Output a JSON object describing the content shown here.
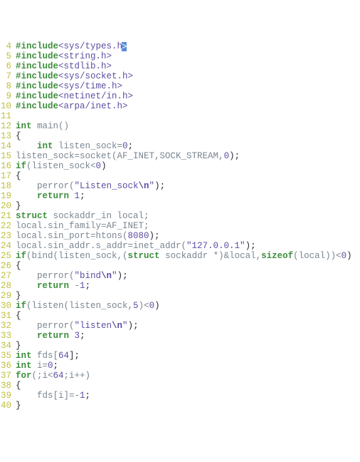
{
  "lines": [
    {
      "n": 4,
      "tokens": [
        {
          "t": "#include",
          "c": "pp"
        },
        {
          "t": "<sys/types.h",
          "c": "hdr"
        },
        {
          "t": ">",
          "c": "hdr",
          "cursor": true
        }
      ]
    },
    {
      "n": 5,
      "tokens": [
        {
          "t": "#include",
          "c": "pp"
        },
        {
          "t": "<string.h>",
          "c": "hdr"
        }
      ]
    },
    {
      "n": 6,
      "tokens": [
        {
          "t": "#include",
          "c": "pp"
        },
        {
          "t": "<stdlib.h>",
          "c": "hdr"
        }
      ]
    },
    {
      "n": 7,
      "tokens": [
        {
          "t": "#include",
          "c": "pp"
        },
        {
          "t": "<sys/socket.h>",
          "c": "hdr"
        }
      ]
    },
    {
      "n": 8,
      "tokens": [
        {
          "t": "#include",
          "c": "pp"
        },
        {
          "t": "<sys/time.h>",
          "c": "hdr"
        }
      ]
    },
    {
      "n": 9,
      "tokens": [
        {
          "t": "#include",
          "c": "pp"
        },
        {
          "t": "<netinet/in.h>",
          "c": "hdr"
        }
      ]
    },
    {
      "n": 10,
      "tokens": [
        {
          "t": "#include",
          "c": "pp"
        },
        {
          "t": "<arpa/inet.h>",
          "c": "hdr"
        }
      ]
    },
    {
      "n": 11,
      "tokens": []
    },
    {
      "n": 12,
      "tokens": [
        {
          "t": "int",
          "c": "kw"
        },
        {
          "t": " main()",
          "c": "ty"
        }
      ]
    },
    {
      "n": 13,
      "tokens": [
        {
          "t": "{",
          "c": "p"
        }
      ]
    },
    {
      "n": 14,
      "tokens": [
        {
          "t": "    ",
          "c": "p"
        },
        {
          "t": "int",
          "c": "kw"
        },
        {
          "t": " listen_sock=",
          "c": "ty"
        },
        {
          "t": "0",
          "c": "num"
        },
        {
          "t": ";",
          "c": "p"
        }
      ]
    },
    {
      "n": 15,
      "tokens": [
        {
          "t": "listen_sock=socket(AF_INET,SOCK_STREAM,",
          "c": "ty"
        },
        {
          "t": "0",
          "c": "num"
        },
        {
          "t": ");",
          "c": "p"
        }
      ]
    },
    {
      "n": 16,
      "tokens": [
        {
          "t": "if",
          "c": "kw"
        },
        {
          "t": "(listen_sock<",
          "c": "ty"
        },
        {
          "t": "0",
          "c": "num"
        },
        {
          "t": ")",
          "c": "p"
        }
      ]
    },
    {
      "n": 17,
      "tokens": [
        {
          "t": "{",
          "c": "p"
        }
      ]
    },
    {
      "n": 18,
      "tokens": [
        {
          "t": "    perror(",
          "c": "ty"
        },
        {
          "t": "\"Listen_sock",
          "c": "str"
        },
        {
          "t": "\\n",
          "c": "esc"
        },
        {
          "t": "\"",
          "c": "str"
        },
        {
          "t": ");",
          "c": "p"
        }
      ]
    },
    {
      "n": 19,
      "tokens": [
        {
          "t": "    ",
          "c": "p"
        },
        {
          "t": "return",
          "c": "kw"
        },
        {
          "t": " ",
          "c": "p"
        },
        {
          "t": "1",
          "c": "num"
        },
        {
          "t": ";",
          "c": "p"
        }
      ]
    },
    {
      "n": 20,
      "tokens": [
        {
          "t": "}",
          "c": "p"
        }
      ]
    },
    {
      "n": 21,
      "tokens": [
        {
          "t": "struct",
          "c": "kw"
        },
        {
          "t": " sockaddr_in local;",
          "c": "ty"
        }
      ]
    },
    {
      "n": 22,
      "tokens": [
        {
          "t": "local.sin_family=AF_INET;",
          "c": "ty"
        }
      ]
    },
    {
      "n": 23,
      "tokens": [
        {
          "t": "local.sin_port=htons(",
          "c": "ty"
        },
        {
          "t": "8080",
          "c": "num"
        },
        {
          "t": ");",
          "c": "p"
        }
      ]
    },
    {
      "n": 24,
      "tokens": [
        {
          "t": "local.sin_addr.s_addr=inet_addr(",
          "c": "ty"
        },
        {
          "t": "\"127.0.0.1\"",
          "c": "str"
        },
        {
          "t": ");",
          "c": "p"
        }
      ]
    },
    {
      "n": 25,
      "tokens": [
        {
          "t": "if",
          "c": "kw"
        },
        {
          "t": "(bind(listen_sock,(",
          "c": "ty"
        },
        {
          "t": "struct",
          "c": "kw"
        },
        {
          "t": " sockaddr *)&local,",
          "c": "ty"
        },
        {
          "t": "sizeof",
          "c": "kw"
        },
        {
          "t": "(local))<",
          "c": "ty"
        },
        {
          "t": "0",
          "c": "num"
        },
        {
          "t": ")",
          "c": "p"
        }
      ]
    },
    {
      "n": 26,
      "tokens": [
        {
          "t": "{",
          "c": "p"
        }
      ]
    },
    {
      "n": 27,
      "tokens": [
        {
          "t": "    perror(",
          "c": "ty"
        },
        {
          "t": "\"bind",
          "c": "str"
        },
        {
          "t": "\\n",
          "c": "esc"
        },
        {
          "t": "\"",
          "c": "str"
        },
        {
          "t": ");",
          "c": "p"
        }
      ]
    },
    {
      "n": 28,
      "tokens": [
        {
          "t": "    ",
          "c": "p"
        },
        {
          "t": "return",
          "c": "kw"
        },
        {
          "t": " -",
          "c": "ty"
        },
        {
          "t": "1",
          "c": "num"
        },
        {
          "t": ";",
          "c": "p"
        }
      ]
    },
    {
      "n": 29,
      "tokens": [
        {
          "t": "}",
          "c": "p"
        }
      ]
    },
    {
      "n": 30,
      "tokens": [
        {
          "t": "if",
          "c": "kw"
        },
        {
          "t": "(listen(listen_sock,",
          "c": "ty"
        },
        {
          "t": "5",
          "c": "num"
        },
        {
          "t": ")<",
          "c": "ty"
        },
        {
          "t": "0",
          "c": "num"
        },
        {
          "t": ")",
          "c": "p"
        }
      ]
    },
    {
      "n": 31,
      "tokens": [
        {
          "t": "{",
          "c": "p"
        }
      ]
    },
    {
      "n": 32,
      "tokens": [
        {
          "t": "    perror(",
          "c": "ty"
        },
        {
          "t": "\"listen",
          "c": "str"
        },
        {
          "t": "\\n",
          "c": "esc"
        },
        {
          "t": "\"",
          "c": "str"
        },
        {
          "t": ");",
          "c": "p"
        }
      ]
    },
    {
      "n": 33,
      "tokens": [
        {
          "t": "    ",
          "c": "p"
        },
        {
          "t": "return",
          "c": "kw"
        },
        {
          "t": " ",
          "c": "p"
        },
        {
          "t": "3",
          "c": "num"
        },
        {
          "t": ";",
          "c": "p"
        }
      ]
    },
    {
      "n": 34,
      "tokens": [
        {
          "t": "}",
          "c": "p"
        }
      ]
    },
    {
      "n": 35,
      "tokens": [
        {
          "t": "int",
          "c": "kw"
        },
        {
          "t": " fds[",
          "c": "ty"
        },
        {
          "t": "64",
          "c": "num"
        },
        {
          "t": "];",
          "c": "p"
        }
      ]
    },
    {
      "n": 36,
      "tokens": [
        {
          "t": "int",
          "c": "kw"
        },
        {
          "t": " i=",
          "c": "ty"
        },
        {
          "t": "0",
          "c": "num"
        },
        {
          "t": ";",
          "c": "p"
        }
      ]
    },
    {
      "n": 37,
      "tokens": [
        {
          "t": "for",
          "c": "kw"
        },
        {
          "t": "(;i<",
          "c": "ty"
        },
        {
          "t": "64",
          "c": "num"
        },
        {
          "t": ";i++)",
          "c": "ty"
        }
      ]
    },
    {
      "n": 38,
      "tokens": [
        {
          "t": "{",
          "c": "p"
        }
      ]
    },
    {
      "n": 39,
      "tokens": [
        {
          "t": "    fds[i]=-",
          "c": "ty"
        },
        {
          "t": "1",
          "c": "num"
        },
        {
          "t": ";",
          "c": "p"
        }
      ]
    },
    {
      "n": 40,
      "tokens": [
        {
          "t": "}",
          "c": "p"
        }
      ]
    }
  ]
}
